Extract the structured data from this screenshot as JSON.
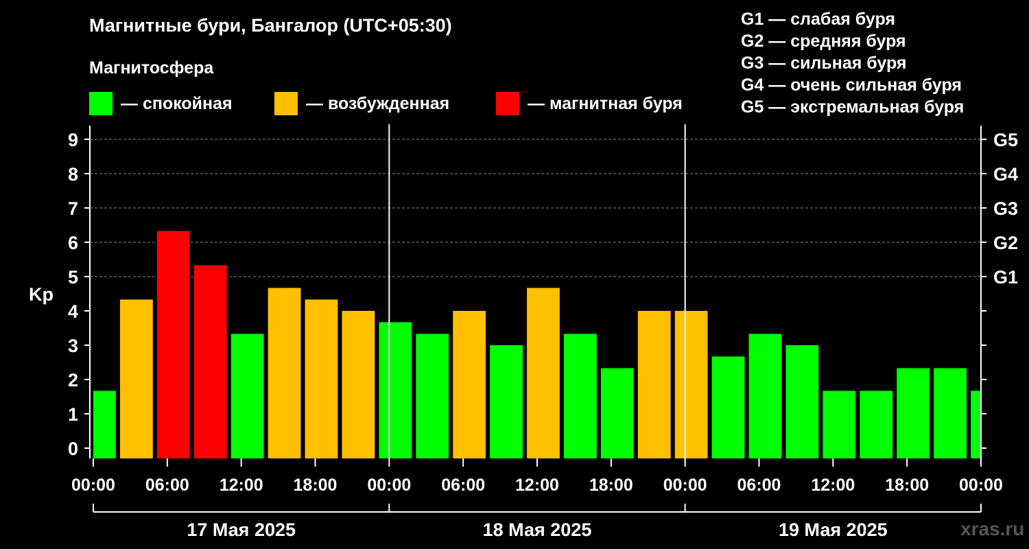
{
  "title": "Магнитные бури, Бангалор (UTC+05:30)",
  "subtitle": "Магнитосфера",
  "legend": [
    {
      "label": "— спокойная",
      "color": "#00ff00"
    },
    {
      "label": "— возбужденная",
      "color": "#ffc000"
    },
    {
      "label": "— магнитная буря",
      "color": "#ff0000"
    }
  ],
  "storm_levels": [
    "G1 — слабая буря",
    "G2 — средняя буря",
    "G3 — сильная буря",
    "G4 — очень сильная буря",
    "G5 — экстремальная буря"
  ],
  "site": "xras.ru",
  "chart_data": {
    "type": "bar",
    "ylabel": "Kp",
    "ylim": [
      -0.3,
      9.4
    ],
    "yticks": [
      0,
      1,
      2,
      3,
      4,
      5,
      6,
      7,
      8,
      9
    ],
    "right_ticks": [
      {
        "y": 5,
        "label": "G1"
      },
      {
        "y": 6,
        "label": "G2"
      },
      {
        "y": 7,
        "label": "G3"
      },
      {
        "y": 8,
        "label": "G4"
      },
      {
        "y": 9,
        "label": "G5"
      },
      {
        "y": 4,
        "label": ""
      },
      {
        "y": 3,
        "label": ""
      },
      {
        "y": 2,
        "label": ""
      },
      {
        "y": 1,
        "label": ""
      },
      {
        "y": 0,
        "label": ""
      }
    ],
    "x_unit": "hours since 17 Мая 2025 00:00",
    "xlim": [
      0,
      72
    ],
    "xtick_labels": [
      "00:00",
      "06:00",
      "12:00",
      "18:00",
      "00:00",
      "06:00",
      "12:00",
      "18:00",
      "00:00",
      "06:00",
      "12:00",
      "18:00",
      "00:00"
    ],
    "days": [
      "17 Мая 2025",
      "18 Мая 2025",
      "19 Мая 2025"
    ],
    "grid_y": [
      5,
      6,
      7,
      8,
      9
    ],
    "bars": [
      {
        "start": 0,
        "end": 1.83,
        "kp": 1.67,
        "color": "#00ff00"
      },
      {
        "start": 2.17,
        "end": 4.83,
        "kp": 4.33,
        "color": "#ffc000"
      },
      {
        "start": 5.17,
        "end": 7.83,
        "kp": 6.33,
        "color": "#ff0000"
      },
      {
        "start": 8.17,
        "end": 10.83,
        "kp": 5.33,
        "color": "#ff0000"
      },
      {
        "start": 11.17,
        "end": 13.83,
        "kp": 3.33,
        "color": "#00ff00"
      },
      {
        "start": 14.17,
        "end": 16.83,
        "kp": 4.67,
        "color": "#ffc000"
      },
      {
        "start": 17.17,
        "end": 19.83,
        "kp": 4.33,
        "color": "#ffc000"
      },
      {
        "start": 20.17,
        "end": 22.83,
        "kp": 4.0,
        "color": "#ffc000"
      },
      {
        "start": 23.17,
        "end": 25.83,
        "kp": 3.67,
        "color": "#00ff00"
      },
      {
        "start": 26.17,
        "end": 28.83,
        "kp": 3.33,
        "color": "#00ff00"
      },
      {
        "start": 29.17,
        "end": 31.83,
        "kp": 4.0,
        "color": "#ffc000"
      },
      {
        "start": 32.17,
        "end": 34.83,
        "kp": 3.0,
        "color": "#00ff00"
      },
      {
        "start": 35.17,
        "end": 37.83,
        "kp": 4.67,
        "color": "#ffc000"
      },
      {
        "start": 38.17,
        "end": 40.83,
        "kp": 3.33,
        "color": "#00ff00"
      },
      {
        "start": 41.17,
        "end": 43.83,
        "kp": 2.33,
        "color": "#00ff00"
      },
      {
        "start": 44.17,
        "end": 46.83,
        "kp": 4.0,
        "color": "#ffc000"
      },
      {
        "start": 47.17,
        "end": 49.83,
        "kp": 4.0,
        "color": "#ffc000"
      },
      {
        "start": 50.17,
        "end": 52.83,
        "kp": 2.67,
        "color": "#00ff00"
      },
      {
        "start": 53.17,
        "end": 55.83,
        "kp": 3.33,
        "color": "#00ff00"
      },
      {
        "start": 56.17,
        "end": 58.83,
        "kp": 3.0,
        "color": "#00ff00"
      },
      {
        "start": 59.17,
        "end": 61.83,
        "kp": 1.67,
        "color": "#00ff00"
      },
      {
        "start": 62.17,
        "end": 64.83,
        "kp": 1.67,
        "color": "#00ff00"
      },
      {
        "start": 65.17,
        "end": 67.83,
        "kp": 2.33,
        "color": "#00ff00"
      },
      {
        "start": 68.17,
        "end": 70.83,
        "kp": 2.33,
        "color": "#00ff00"
      },
      {
        "start": 71.17,
        "end": 72,
        "kp": 1.67,
        "color": "#00ff00"
      }
    ],
    "day_dividers": [
      24,
      48
    ]
  }
}
